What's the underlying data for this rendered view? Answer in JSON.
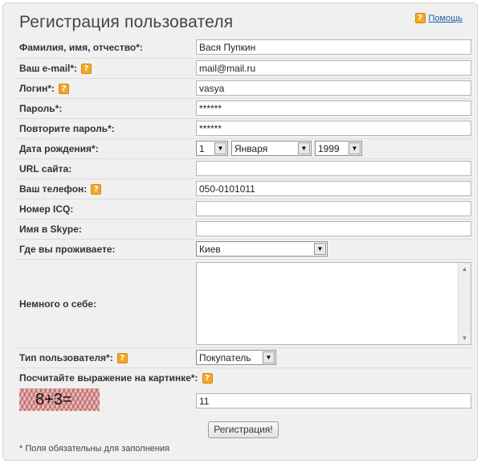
{
  "header": {
    "title": "Регистрация пользователя",
    "help_label": "Помощь",
    "help_icon": "question-icon"
  },
  "fields": {
    "fullname": {
      "label": "Фамилия, имя, отчество*:",
      "value": "Вася Пупкин"
    },
    "email": {
      "label": "Ваш e-mail*:",
      "value": "mail@mail.ru"
    },
    "login": {
      "label": "Логин*:",
      "value": "vasya"
    },
    "password": {
      "label": "Пароль*:",
      "value": "******"
    },
    "password_repeat": {
      "label": "Повторите пароль*:",
      "value": "******"
    },
    "birthdate": {
      "label": "Дата рождения*:",
      "day": "1",
      "month": "Января",
      "year": "1999"
    },
    "url": {
      "label": "URL сайта:",
      "value": ""
    },
    "phone": {
      "label": "Ваш телефон:",
      "value": "050-0101011"
    },
    "icq": {
      "label": "Номер ICQ:",
      "value": ""
    },
    "skype": {
      "label": "Имя в Skype:",
      "value": ""
    },
    "city": {
      "label": "Где вы проживаете:",
      "value": "Киев"
    },
    "about": {
      "label": "Немного о себе:",
      "value": ""
    },
    "user_type": {
      "label": "Тип пользователя*:",
      "value": "Покупатель"
    },
    "captcha": {
      "label": "Посчитайте выражение на картинке*:",
      "image_text": "8+3=",
      "value": "11"
    }
  },
  "submit_label": "Регистрация!",
  "footnote": "* Поля обязательны для заполнения",
  "colors": {
    "help_icon": "#f5a623",
    "link": "#1a5fa8",
    "panel": "#f0f0f0"
  }
}
